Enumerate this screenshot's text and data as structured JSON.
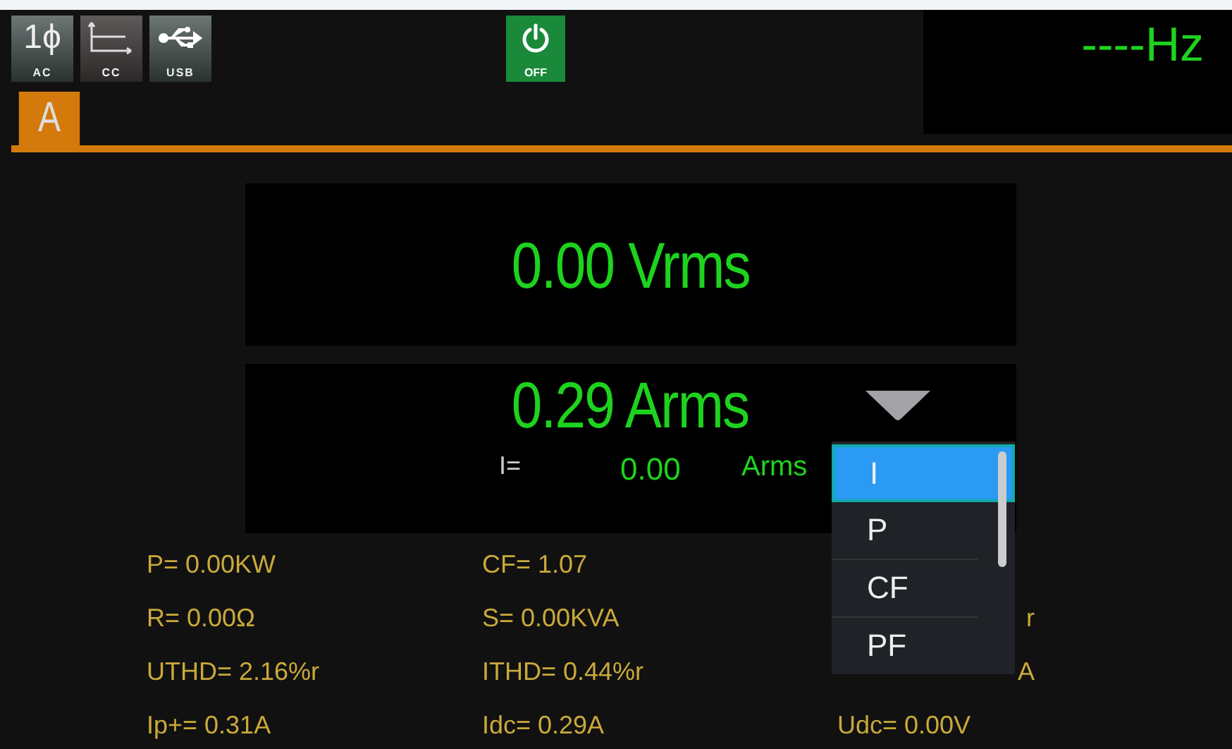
{
  "status_icons": [
    {
      "kind": "phase",
      "symbol": "1ϕ",
      "label": "AC"
    },
    {
      "kind": "cc",
      "label": "CC"
    },
    {
      "kind": "usb",
      "label": "USB"
    }
  ],
  "output_button": {
    "label": "OFF",
    "on": false
  },
  "frequency": "----Hz",
  "channel_tab": "A",
  "voltage": {
    "value": "0.00",
    "unit": "Vrms"
  },
  "current": {
    "value": "0.29",
    "unit": "Arms",
    "sub_label": "I=",
    "sub_value": "0.00",
    "sub_unit": "Arms"
  },
  "params": [
    {
      "text": "P=  0.00KW",
      "kind": "full"
    },
    {
      "text": "CF=  1.07",
      "kind": "full"
    },
    {
      "kind": "none"
    },
    {
      "text": "R=  0.00Ω",
      "kind": "full"
    },
    {
      "text": "S=  0.00KVA",
      "kind": "full"
    },
    {
      "text": "r",
      "kind": "fragment"
    },
    {
      "text": "UTHD=  2.16%r",
      "kind": "full"
    },
    {
      "text": "ITHD=  0.44%r",
      "kind": "full"
    },
    {
      "text": "A",
      "kind": "fragment"
    },
    {
      "text": "Ip+= 0.31A",
      "kind": "full"
    },
    {
      "text": "Idc= 0.29A",
      "kind": "full"
    },
    {
      "text": "Udc=  0.00V",
      "kind": "full"
    }
  ],
  "dropdown": {
    "items": [
      {
        "label": "I",
        "selected": true
      },
      {
        "label": "P",
        "selected": false
      },
      {
        "label": "CF",
        "selected": false
      },
      {
        "label": "PF",
        "selected": false
      }
    ]
  }
}
